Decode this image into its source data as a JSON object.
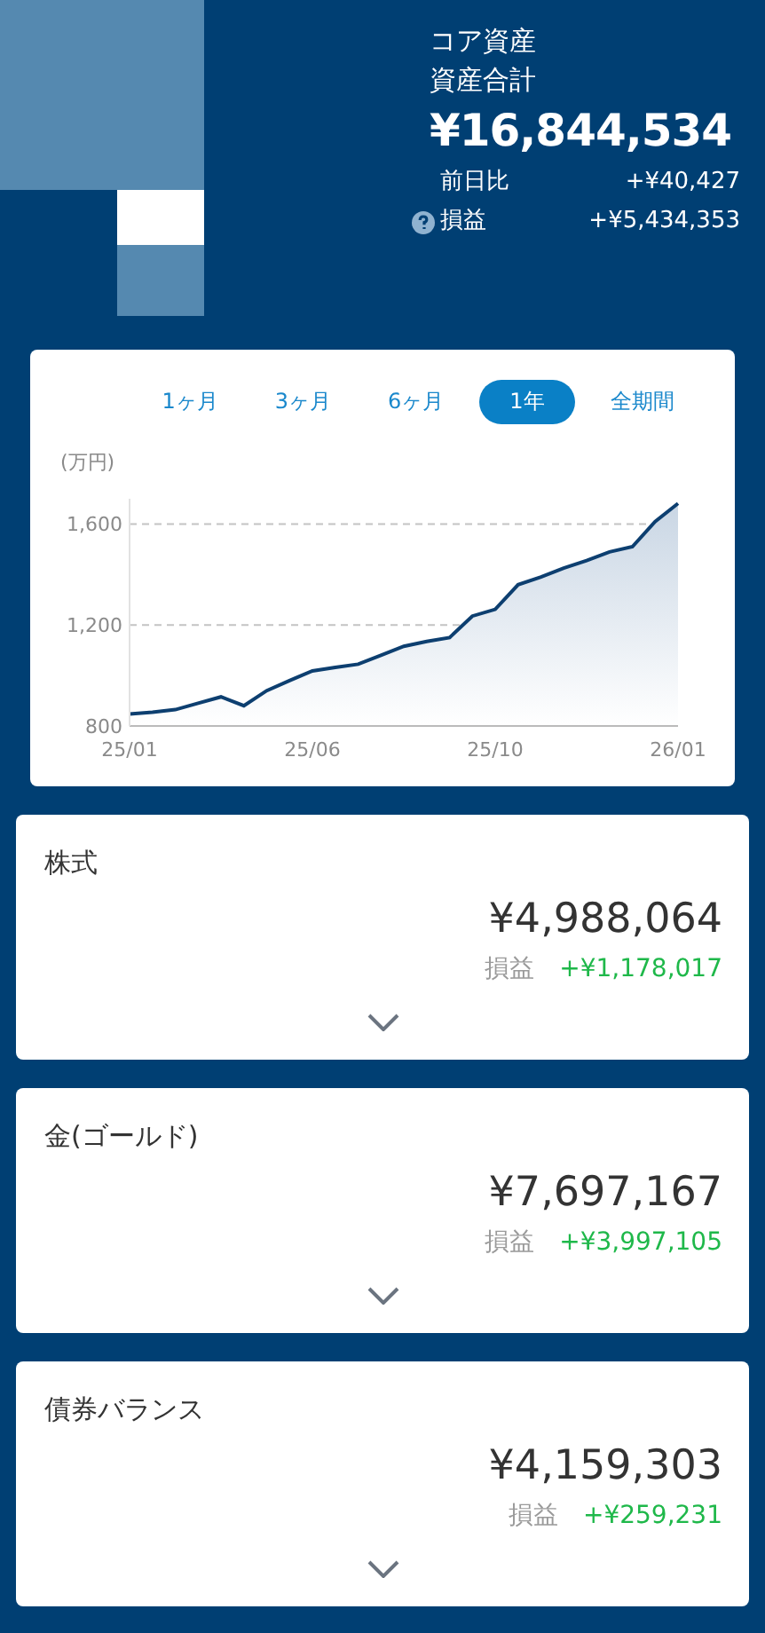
{
  "header": {
    "category": "コア資産",
    "label": "資産合計",
    "total": "¥16,844,534",
    "rows": [
      {
        "kind": "plain",
        "label": "前日比",
        "value": "+¥40,427"
      },
      {
        "kind": "help",
        "label": "損益",
        "value": "+¥5,434,353"
      }
    ]
  },
  "chart": {
    "tabs": [
      {
        "label": "1ヶ月",
        "selected": false
      },
      {
        "label": "3ヶ月",
        "selected": false
      },
      {
        "label": "6ヶ月",
        "selected": false
      },
      {
        "label": "1年",
        "selected": true
      },
      {
        "label": "全期間",
        "selected": false
      }
    ],
    "chart_data": {
      "type": "area",
      "ylabel": "(万円)",
      "categories": [
        "25/01",
        null,
        null,
        null,
        null,
        null,
        null,
        null,
        "25/06",
        null,
        null,
        null,
        null,
        null,
        null,
        null,
        "25/10",
        null,
        null,
        null,
        null,
        null,
        null,
        null,
        "26/01"
      ],
      "ylim": [
        800,
        1700
      ],
      "series": [
        {
          "color": "#0d3f70",
          "values": [
            847,
            855,
            865,
            890,
            915,
            880,
            940,
            980,
            1018,
            1032,
            1045,
            1080,
            1116,
            1135,
            1150,
            1235,
            1262,
            1360,
            1390,
            1425,
            1455,
            1490,
            1510,
            1610,
            1682
          ]
        }
      ],
      "yticks": [
        {
          "value": 800,
          "label": "800"
        },
        {
          "value": 1200,
          "label": "1,200"
        },
        {
          "value": 1600,
          "label": "1,600"
        }
      ]
    }
  },
  "assets": [
    {
      "name": "株式",
      "value": "¥4,988,064",
      "pl_label": "損益",
      "pl_value": "+¥1,178,017",
      "expanded": false
    },
    {
      "name": "金(ゴールド)",
      "value": "¥7,697,167",
      "pl_label": "損益",
      "pl_value": "+¥3,997,105",
      "expanded": false
    },
    {
      "name": "債券バランス",
      "value": "¥4,159,303",
      "pl_label": "損益",
      "pl_value": "+¥259,231",
      "expanded": false
    }
  ]
}
